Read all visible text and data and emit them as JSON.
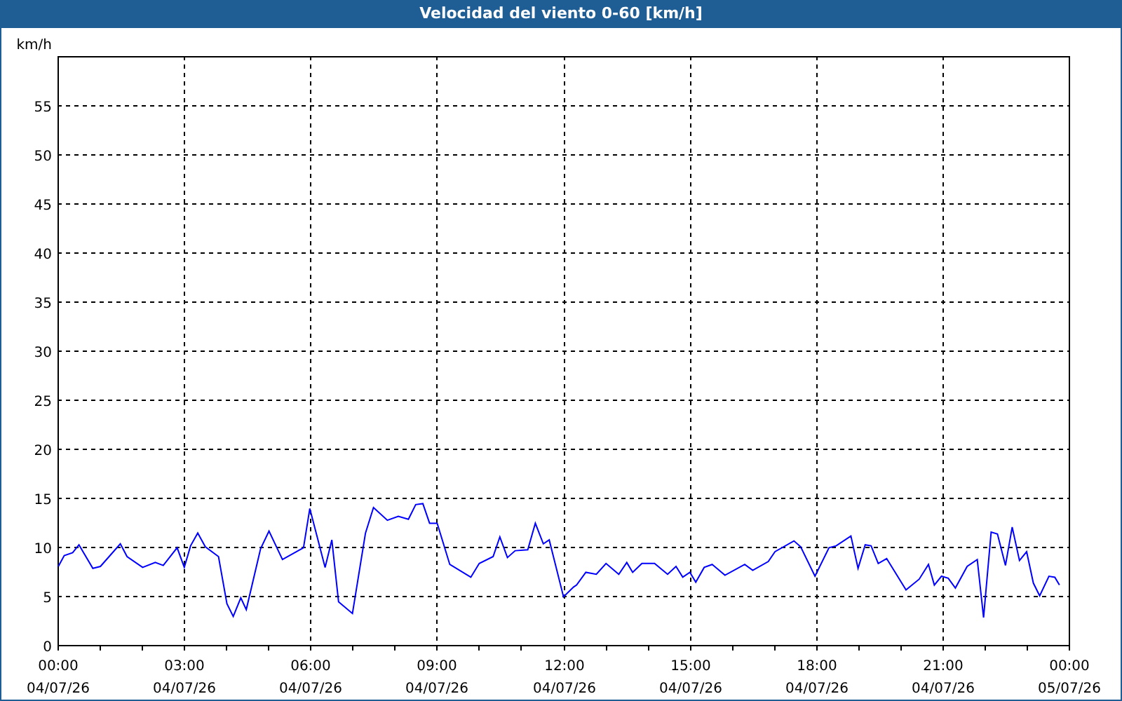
{
  "window": {
    "title": "Velocidad del viento 0-60 [km/h]"
  },
  "chart": {
    "chart_data": {
      "type": "line",
      "grid": true,
      "ylabel": "km/h",
      "xlim": [
        0,
        24
      ],
      "ylim": [
        0,
        60
      ],
      "yticks": [
        0,
        5,
        10,
        15,
        20,
        25,
        30,
        35,
        40,
        45,
        50,
        55
      ],
      "xticks": [
        {
          "value": 0,
          "label": "00:00"
        },
        {
          "value": 3,
          "label": "03:00"
        },
        {
          "value": 6,
          "label": "06:00"
        },
        {
          "value": 9,
          "label": "09:00"
        },
        {
          "value": 12,
          "label": "12:00"
        },
        {
          "value": 15,
          "label": "15:00"
        },
        {
          "value": 18,
          "label": "18:00"
        },
        {
          "value": 21,
          "label": "21:00"
        },
        {
          "value": 24,
          "label": "00:00"
        }
      ],
      "annotations": [
        "04/07/26",
        "04/07/26",
        "04/07/26",
        "04/07/26",
        "04/07/26",
        "04/07/26",
        "04/07/26",
        "04/07/26",
        "05/07/26"
      ],
      "x": [
        0.02,
        0.16,
        0.36,
        0.51,
        0.84,
        1.02,
        1.49,
        1.65,
        2.02,
        2.32,
        2.51,
        2.84,
        3.01,
        3.16,
        3.33,
        3.51,
        3.82,
        4.02,
        4.17,
        4.35,
        4.48,
        4.82,
        5.02,
        5.34,
        5.84,
        5.99,
        6.35,
        6.51,
        6.67,
        7.0,
        7.31,
        7.5,
        7.83,
        8.09,
        8.33,
        8.5,
        8.67,
        8.83,
        9.01,
        9.31,
        9.81,
        10.01,
        10.34,
        10.5,
        10.68,
        10.86,
        11.16,
        11.34,
        11.53,
        11.67,
        12.01,
        12.25,
        12.32,
        12.54,
        12.79,
        13.02,
        13.32,
        13.51,
        13.65,
        13.87,
        14.17,
        14.48,
        14.68,
        14.84,
        15.01,
        15.15,
        15.35,
        15.54,
        15.84,
        16.31,
        16.5,
        16.87,
        17.03,
        17.48,
        17.64,
        17.98,
        18.31,
        18.48,
        18.83,
        19.0,
        19.17,
        19.31,
        19.48,
        19.68,
        20.14,
        20.45,
        20.67,
        20.81,
        20.98,
        21.14,
        21.31,
        21.59,
        21.83,
        21.98,
        22.16,
        22.31,
        22.5,
        22.66,
        22.83,
        23.0,
        23.16,
        23.31,
        23.53,
        23.67,
        23.78
      ],
      "series": [
        {
          "color": "#0000ff",
          "values": [
            8.0,
            9.1,
            9.4,
            10.2,
            7.8,
            8.0,
            10.3,
            9.0,
            7.9,
            8.4,
            8.1,
            9.9,
            7.9,
            10.1,
            11.4,
            10.0,
            9.0,
            4.2,
            2.9,
            4.8,
            3.6,
            9.8,
            11.6,
            8.7,
            9.9,
            13.9,
            7.9,
            10.7,
            4.4,
            3.2,
            11.4,
            14.0,
            12.7,
            13.1,
            12.8,
            14.3,
            14.4,
            12.4,
            12.4,
            8.2,
            6.9,
            8.3,
            9.0,
            11.0,
            8.9,
            9.6,
            9.7,
            12.4,
            10.3,
            10.7,
            4.9,
            5.9,
            6.1,
            7.4,
            7.2,
            8.3,
            7.2,
            8.4,
            7.4,
            8.3,
            8.3,
            7.2,
            8.0,
            6.9,
            7.4,
            6.4,
            7.9,
            8.2,
            7.1,
            8.2,
            7.6,
            8.5,
            9.5,
            10.6,
            10.0,
            7.0,
            9.9,
            10.1,
            11.1,
            7.8,
            10.2,
            10.1,
            8.3,
            8.8,
            5.6,
            6.7,
            8.2,
            6.1,
            7.0,
            6.8,
            5.8,
            8.0,
            8.7,
            2.8,
            11.5,
            11.3,
            8.1,
            12.0,
            8.6,
            9.5,
            6.3,
            5.0,
            7.0,
            6.9,
            6.1
          ]
        }
      ]
    }
  }
}
